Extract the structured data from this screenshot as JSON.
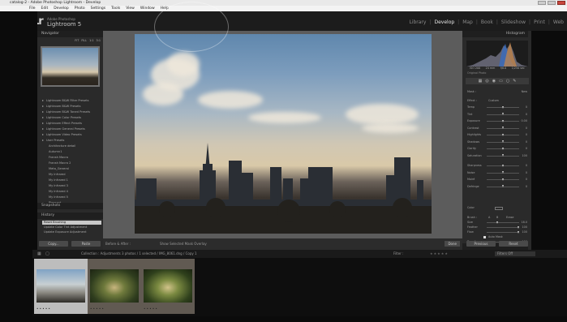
{
  "window": {
    "title": "catalog-2 - Adobe Photoshop Lightroom - Develop"
  },
  "menu": [
    "File",
    "Edit",
    "Develop",
    "Photo",
    "Settings",
    "Tools",
    "View",
    "Window",
    "Help"
  ],
  "identity": {
    "logo": "Lr",
    "brand_small": "Adobe Photoshop",
    "brand_big": "Lightroom 5"
  },
  "modules": {
    "items": [
      "Library",
      "Develop",
      "Map",
      "Book",
      "Slideshow",
      "Print",
      "Web"
    ],
    "active": "Develop"
  },
  "left_panel": {
    "navigator_title": "Navigator",
    "navigator_zoom": [
      "FIT",
      "FILL",
      "1:1",
      "3:1"
    ],
    "presets": [
      "Lightroom B&W Filter Presets",
      "Lightroom B&W Presets",
      "Lightroom B&W Toned Presets",
      "Lightroom Color Presets",
      "Lightroom Effect Presets",
      "Lightroom General Presets",
      "Lightroom Video Presets",
      "User Presets"
    ],
    "user_presets": [
      "Architecture detail",
      "Autumn1",
      "Fransh Macro",
      "Fransh Macro 2",
      "Meta_General",
      "My Infrared",
      "My Infrared 1",
      "My Infrared 3",
      "My Infrared 4",
      "My Infrared 5",
      "Pleasant"
    ],
    "snapshots_title": "Snapshots",
    "history_title": "History",
    "history": [
      "Reset Brushing",
      "Update Color Tint Adjustment",
      "Update Exposure Adjustment"
    ],
    "copy_label": "Copy...",
    "paste_label": "Paste"
  },
  "toolbar": {
    "before_after": "Before & After :",
    "show_edit_pins": "Show Selected Mask Overlay",
    "done_label": "Done"
  },
  "right_panel": {
    "histogram_title": "Histogram",
    "exif": [
      "ISO 200",
      "24 mm",
      "f/8.0",
      "1/250 sec"
    ],
    "original_photo": "Original Photo",
    "mask_label": "Mask :",
    "mask_value": "New",
    "effect_label": "Effect :",
    "effect_value": "Custom",
    "sliders": [
      {
        "label": "Temp",
        "value": "0"
      },
      {
        "label": "Tint",
        "value": "0"
      },
      {
        "label": "Exposure",
        "value": "0.00"
      },
      {
        "label": "Contrast",
        "value": "0"
      },
      {
        "label": "Highlights",
        "value": "0"
      },
      {
        "label": "Shadows",
        "value": "0"
      },
      {
        "label": "Clarity",
        "value": "0"
      },
      {
        "label": "Saturation",
        "value": "100"
      },
      {
        "label": "Sharpness",
        "value": "0"
      },
      {
        "label": "Noise",
        "value": "0"
      },
      {
        "label": "Moiré",
        "value": "0"
      },
      {
        "label": "Defringe",
        "value": "0"
      }
    ],
    "color_label": "Color",
    "brush_label": "Brush :",
    "brush_a": "A",
    "brush_b": "B",
    "brush_erase": "Erase",
    "brush_sliders": [
      {
        "label": "Size",
        "value": "18.0"
      },
      {
        "label": "Feather",
        "value": "100"
      },
      {
        "label": "Flow",
        "value": "100"
      }
    ],
    "auto_mask": "Auto Mask",
    "density_label": "Density",
    "density_value": "100",
    "reset_label": "Reset",
    "close_label": "Close",
    "basic_title": "Basic",
    "previous_label": "Previous",
    "reset_button": "Reset"
  },
  "filmstrip_header": {
    "collection": "Collection : Adjustments",
    "count": "3 photos / 1 selected / IMG_8061.dng / Copy 1",
    "filter_label": "Filter :",
    "filter_value": "Filters Off"
  },
  "filmstrip": [
    {
      "name": "thumb-city",
      "stars": "• • • • •",
      "selected": true
    },
    {
      "name": "thumb-forest-1",
      "stars": "• • • • •",
      "selected": false
    },
    {
      "name": "thumb-forest-2",
      "stars": "• • • • •",
      "selected": false
    }
  ]
}
